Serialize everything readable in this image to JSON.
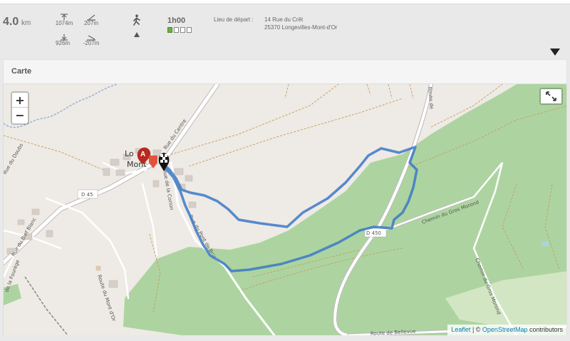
{
  "summary": {
    "distance_value": "4.0",
    "distance_unit": "km",
    "alt_max": "1074m",
    "alt_min": "926m",
    "elev_gain": "207m",
    "elev_loss": "-207m",
    "duration": "1h00",
    "difficulty_level": 1,
    "difficulty_max": 4,
    "departure_label": "Lieu de départ :",
    "departure_line1": "14 Rue du Crêt",
    "departure_line2": "25370 Longevilles-Mont-d'Or"
  },
  "map_card": {
    "title": "Carte",
    "zoom_in": "+",
    "zoom_out": "−",
    "marker_start": "A",
    "town_label_1": "Lo",
    "town_label_2": "Mont",
    "road_labels": {
      "d45": "D 45",
      "d450": "D 450",
      "rue_du_centre": "Rue du Centre",
      "rue_du_doubs": "Rue du Doubs",
      "rue_du_bief_blanc": "Rue du Bief Blanc",
      "rue_de_la_corion": "Rue de la Corion",
      "rue_du_pont_de_bois": "Rue du Pont de Bois",
      "route_du_mont_dor": "Route du Mont d'Or",
      "chemin_gros_morond_1": "Chemin du Gros Morond",
      "chemin_gros_morond_2": "Chemin du Gros Morond",
      "route_de_bellevue": "Route de Bellevue",
      "route_de_left": "de la Fourège",
      "route_top": "Route de"
    },
    "attribution_leaflet": "Leaflet",
    "attribution_sep": " | © ",
    "attribution_osm": "OpenStreetMap",
    "attribution_tail": " contributors"
  },
  "colors": {
    "route": "#3b78c8",
    "forest": "#a8cf93",
    "land": "#eeeae5"
  }
}
